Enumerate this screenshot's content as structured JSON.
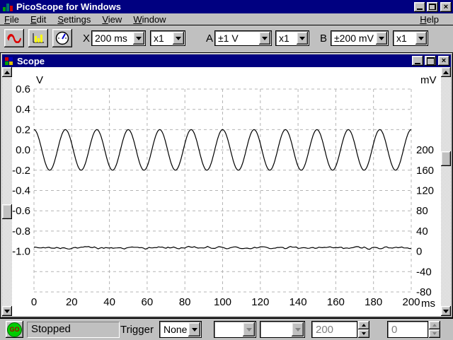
{
  "title_bar": {
    "title": "PicoScope for Windows"
  },
  "menu_bar": {
    "items": [
      "File",
      "Edit",
      "Settings",
      "View",
      "Window"
    ],
    "help": "Help"
  },
  "toolbar": {
    "icons": {
      "view1": "sine-wave",
      "view2": "spectrum-bars",
      "view3": "meter-gauge"
    },
    "x_label": "X",
    "timebase": "200 ms",
    "x_multiplier": "x1",
    "channel_a_label": "A",
    "channel_a_range": "±1 V",
    "channel_a_multiplier": "x1",
    "channel_b_label": "B",
    "channel_b_range": "±200 mV",
    "channel_b_multiplier": "x1"
  },
  "scope_window": {
    "title": "Scope"
  },
  "status_bar": {
    "go_button": "GO",
    "status": "Stopped",
    "trigger_label": "Trigger",
    "trigger_mode": "None",
    "trigger_source": "",
    "trigger_direction": "",
    "trigger_threshold": "200",
    "trigger_delay": "0"
  },
  "chart_data": {
    "type": "line",
    "grid": true,
    "x_axis": {
      "label": "ms",
      "min": 0,
      "max": 200,
      "tick_step": 20,
      "tick_labels": [
        0,
        20,
        40,
        60,
        80,
        100,
        120,
        140,
        160,
        180,
        200
      ]
    },
    "left_axis": {
      "label": "V",
      "max": 0.6,
      "min": -1.4,
      "grid_step": 0.2,
      "labeled_ticks": [
        0.6,
        0.4,
        0.2,
        0.0,
        -0.2,
        -0.4,
        -0.6,
        -0.8,
        -1.0
      ]
    },
    "right_axis": {
      "label": "mV",
      "labeled_ticks": [
        200,
        160,
        120,
        80,
        40,
        0,
        -40,
        -80
      ],
      "mv_per_left_volt": 200,
      "zero_at_left_v": -1.0
    },
    "series": [
      {
        "name": "channel-a",
        "shape": "sine",
        "axis": "left",
        "amplitude_v": 0.2,
        "offset_v": 0.0,
        "frequency_hz": 60,
        "phase": "cosine"
      },
      {
        "name": "channel-b",
        "shape": "noisy-flat",
        "axis": "right",
        "level_mv": 7,
        "noise_mv": 3
      }
    ]
  }
}
